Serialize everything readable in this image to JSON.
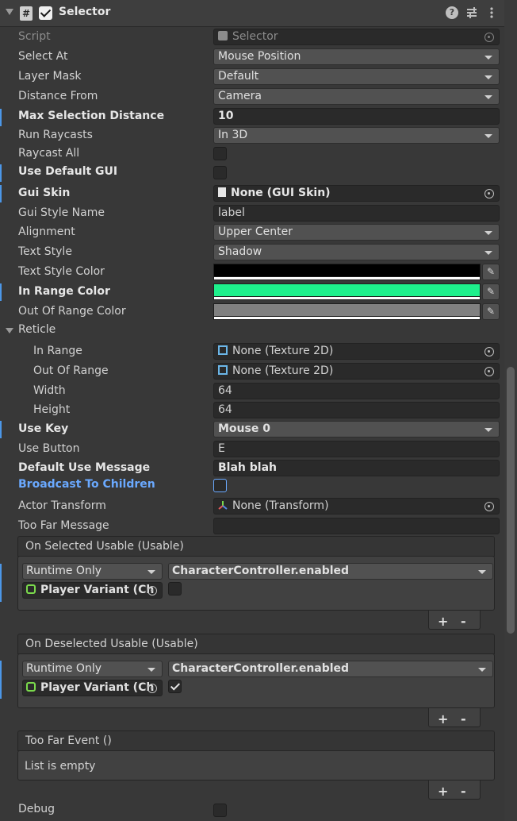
{
  "header": {
    "title": "Selector"
  },
  "rows": {
    "script": {
      "label": "Script",
      "value": "Selector"
    },
    "select_at": {
      "label": "Select At",
      "value": "Mouse Position"
    },
    "layer_mask": {
      "label": "Layer Mask",
      "value": "Default"
    },
    "distance_from": {
      "label": "Distance From",
      "value": "Camera"
    },
    "max_sel_dist": {
      "label": "Max Selection Distance",
      "value": "10"
    },
    "run_raycasts": {
      "label": "Run Raycasts",
      "value": "In 3D"
    },
    "raycast_all": {
      "label": "Raycast All"
    },
    "use_default_gui": {
      "label": "Use Default GUI"
    },
    "gui_skin": {
      "label": "Gui Skin",
      "value": "None (GUI Skin)"
    },
    "gui_style_name": {
      "label": "Gui Style Name",
      "value": "label"
    },
    "alignment": {
      "label": "Alignment",
      "value": "Upper Center"
    },
    "text_style": {
      "label": "Text Style",
      "value": "Shadow"
    },
    "text_style_color": {
      "label": "Text Style Color",
      "color": "#000000"
    },
    "in_range_color": {
      "label": "In Range Color",
      "color": "#1ef08c"
    },
    "out_of_range_color": {
      "label": "Out Of Range Color",
      "color": "#808080"
    },
    "reticle": {
      "label": "Reticle"
    },
    "in_range": {
      "label": "In Range",
      "value": "None (Texture 2D)"
    },
    "out_of_range": {
      "label": "Out Of Range",
      "value": "None (Texture 2D)"
    },
    "width": {
      "label": "Width",
      "value": "64"
    },
    "height": {
      "label": "Height",
      "value": "64"
    },
    "use_key": {
      "label": "Use Key",
      "value": "Mouse 0"
    },
    "use_button": {
      "label": "Use Button",
      "value": "E"
    },
    "default_use_message": {
      "label": "Default Use Message",
      "value": "Blah blah"
    },
    "broadcast_to_children": {
      "label": "Broadcast To Children"
    },
    "actor_transform": {
      "label": "Actor Transform",
      "value": "None (Transform)"
    },
    "too_far_message": {
      "label": "Too Far Message",
      "value": ""
    },
    "debug": {
      "label": "Debug"
    }
  },
  "events": {
    "on_selected": {
      "title": "On Selected Usable (Usable)",
      "mode": "Runtime Only",
      "function": "CharacterController.enabled",
      "target": "Player Variant (Ch"
    },
    "on_deselected": {
      "title": "On Deselected Usable (Usable)",
      "mode": "Runtime Only",
      "function": "CharacterController.enabled",
      "target": "Player Variant (Ch"
    },
    "too_far": {
      "title": "Too Far Event ()",
      "empty": "List is empty"
    },
    "plus": "+",
    "minus": "-"
  }
}
